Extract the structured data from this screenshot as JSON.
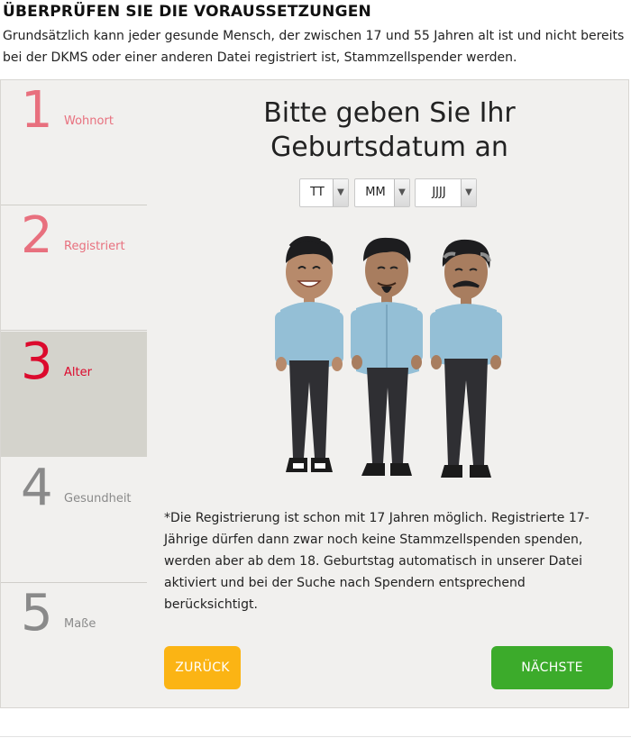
{
  "heading": "ÜBERPRÜFEN SIE DIE VORAUSSETZUNGEN",
  "intro": "Grundsätzlich kann jeder gesunde Mensch, der zwischen 17 und 55 Jahren alt ist und nicht bereits bei der DKMS oder einer anderen Datei registriert ist, Stammzellspender werden.",
  "steps": [
    {
      "num": "1",
      "label": "Wohnort",
      "state": "done"
    },
    {
      "num": "2",
      "label": "Registriert",
      "state": "done"
    },
    {
      "num": "3",
      "label": "Alter",
      "state": "active"
    },
    {
      "num": "4",
      "label": "Gesundheit",
      "state": "todo"
    },
    {
      "num": "5",
      "label": "Maße",
      "state": "todo"
    }
  ],
  "question": "Bitte geben Sie Ihr Geburtsdatum an",
  "birthdate": {
    "day": "TT",
    "month": "MM",
    "year": "JJJJ"
  },
  "illustration": "three-men-icon",
  "note": "*Die Registrierung ist schon mit 17 Jahren möglich. Registrierte 17-Jährige dürfen dann zwar noch keine Stammzellspenden spenden, werden aber ab dem 18. Geburtstag automatisch in unserer Datei aktiviert und bei der Suche nach Spendern entsprechend berücksichtigt.",
  "buttons": {
    "back": "ZURÜCK",
    "next": "NÄCHSTE"
  },
  "colors": {
    "step_done": "#e8707e",
    "step_active": "#dc0a2d",
    "step_todo": "#8a8a8a",
    "back_button": "#fbb414",
    "next_button": "#3cab2b"
  }
}
